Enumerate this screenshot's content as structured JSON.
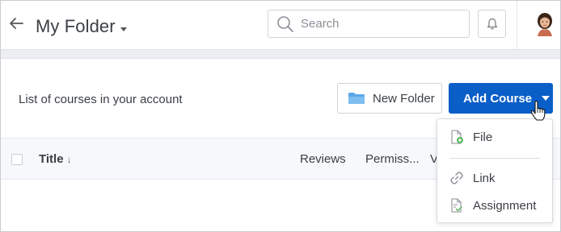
{
  "header": {
    "title": "My Folder",
    "search_placeholder": "Search"
  },
  "toolbar": {
    "description": "List of courses in your account",
    "new_folder_label": "New Folder",
    "add_course_label": "Add Course"
  },
  "table": {
    "columns": [
      "Title",
      "Reviews",
      "Permiss...",
      "V"
    ],
    "sort_indicator": "↓"
  },
  "dropdown": {
    "items": [
      {
        "label": "File",
        "icon": "file-add-icon"
      },
      {
        "label": "Link",
        "icon": "link-icon"
      },
      {
        "label": "Assignment",
        "icon": "assignment-icon"
      }
    ]
  },
  "colors": {
    "primary": "#0a5ec7",
    "folder": "#5aa7e8",
    "success": "#5cb85c"
  },
  "icons": [
    "back-arrow-icon",
    "chevron-down-icon",
    "search-icon",
    "bell-icon",
    "avatar",
    "folder-icon",
    "caret-down-icon",
    "pointer-cursor-icon"
  ]
}
